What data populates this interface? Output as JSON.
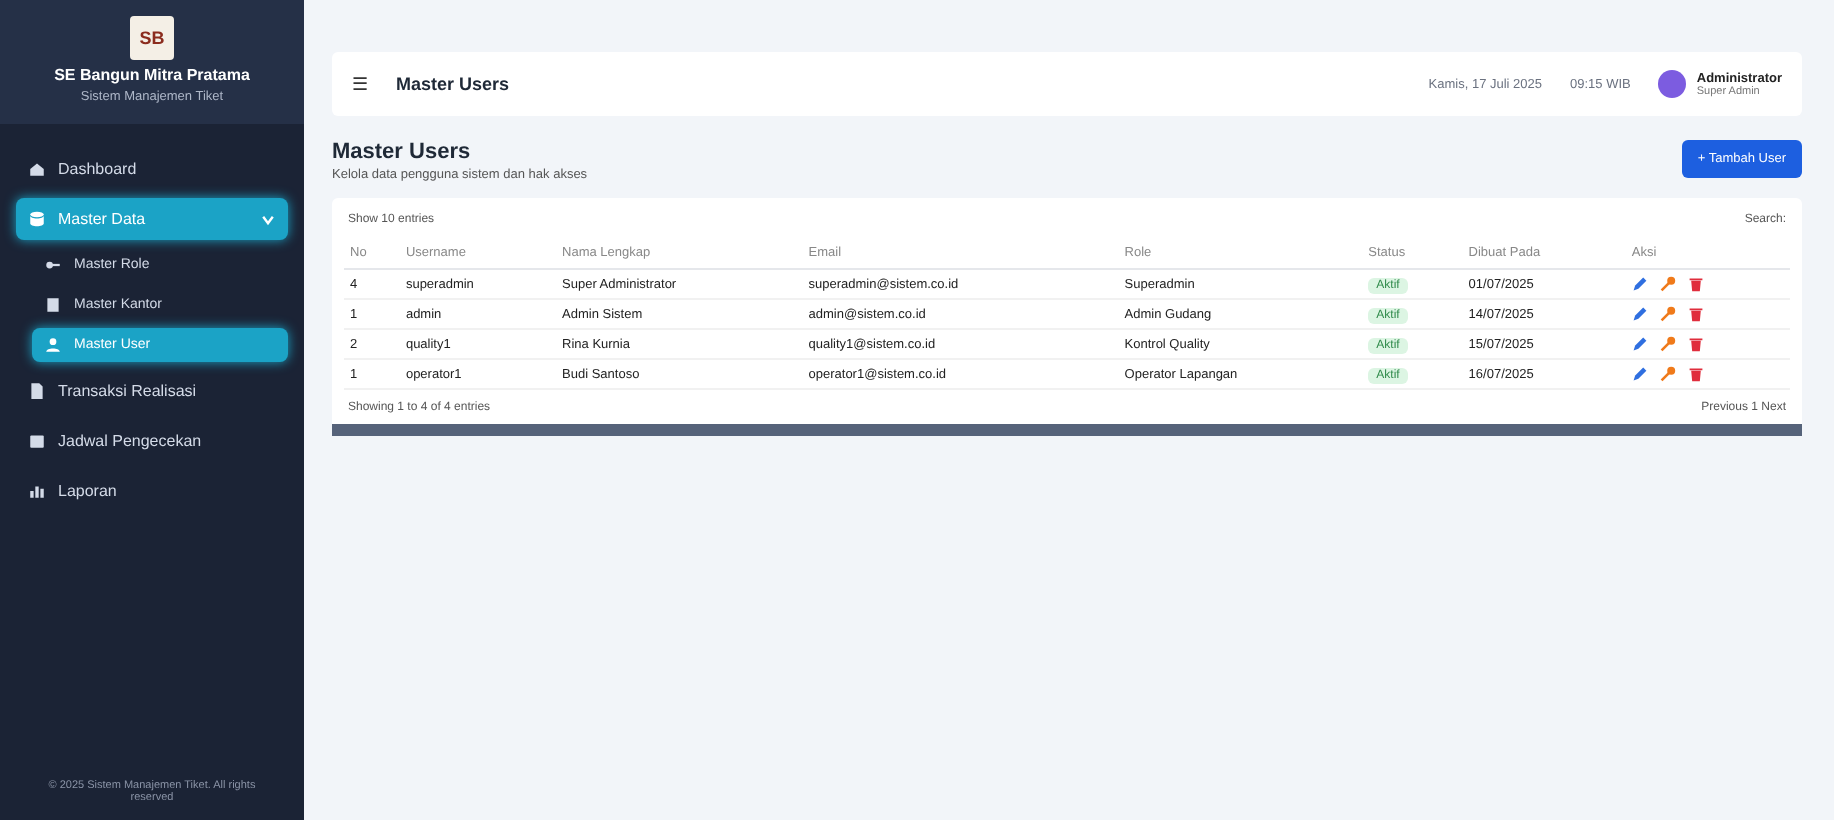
{
  "sidebar": {
    "logo_text": "SB",
    "title": "SE Bangun Mitra Pratama",
    "subtitle": "Sistem Manajemen Tiket",
    "items": [
      {
        "label": "Dashboard",
        "selected": false
      },
      {
        "label": "Master Data",
        "selected": true,
        "expanded": true,
        "children": [
          {
            "label": "Master Role",
            "selected": false
          },
          {
            "label": "Master Kantor",
            "selected": false
          },
          {
            "label": "Master User",
            "selected": true
          }
        ]
      },
      {
        "label": "Transaksi Realisasi",
        "selected": false
      },
      {
        "label": "Jadwal Pengecekan",
        "selected": false
      },
      {
        "label": "Laporan",
        "selected": false
      }
    ],
    "footer": "© 2025 Sistem Manajemen Tiket. All rights reserved"
  },
  "header": {
    "menu_glyph": "☰",
    "title": "Master Users",
    "date": "Kamis, 17 Juli 2025",
    "time": "09:15 WIB",
    "user_name": "Administrator",
    "user_role": "Super Admin"
  },
  "page": {
    "title": "Master Users",
    "subtitle": "Kelola data pengguna sistem dan hak akses",
    "add_button": "+ Tambah User"
  },
  "table": {
    "length_label": "Show 10 entries",
    "search_label": "Search:",
    "columns": [
      "No",
      "Username",
      "Nama Lengkap",
      "Email",
      "Role",
      "Status",
      "Dibuat Pada",
      "Aksi"
    ],
    "rows": [
      {
        "cells": [
          "4",
          "superadmin",
          "Super Administrator",
          "superadmin@sistem.co.id",
          "Superadmin",
          "Aktif",
          "01/07/2025"
        ]
      },
      {
        "cells": [
          "1",
          "admin",
          "Admin Sistem",
          "admin@sistem.co.id",
          "Admin Gudang",
          "Aktif",
          "14/07/2025"
        ]
      },
      {
        "cells": [
          "2",
          "quality1",
          "Rina Kurnia",
          "quality1@sistem.co.id",
          "Kontrol Quality",
          "Aktif",
          "15/07/2025"
        ]
      },
      {
        "cells": [
          "1",
          "operator1",
          "Budi Santoso",
          "operator1@sistem.co.id",
          "Operator Lapangan",
          "Aktif",
          "16/07/2025"
        ]
      }
    ],
    "info": "Showing 1 to 4 of 4 entries",
    "pager": "Previous 1 Next"
  }
}
